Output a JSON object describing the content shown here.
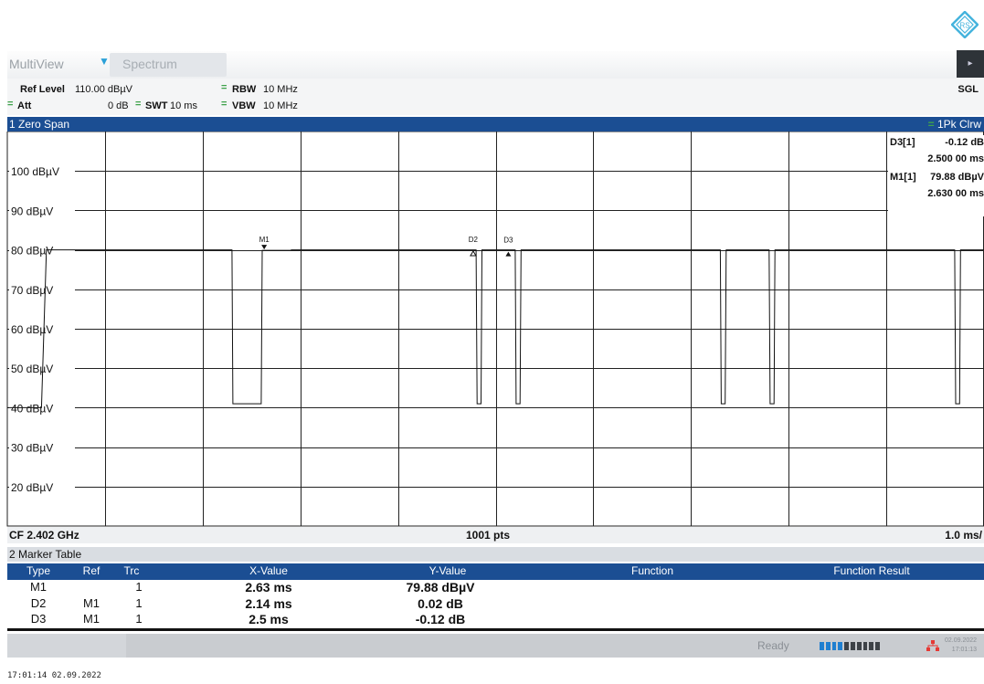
{
  "tabs": {
    "multiview": "MultiView",
    "spectrum": "Spectrum"
  },
  "header": {
    "ref_level_label": "Ref Level",
    "ref_level_value": "110.00 dBµV",
    "att_label": "Att",
    "att_value": "0 dB",
    "swt_label": "SWT",
    "swt_value": "10 ms",
    "rbw_label": "RBW",
    "rbw_value": "10 MHz",
    "vbw_label": "VBW",
    "vbw_value": "10 MHz",
    "mode": "SGL"
  },
  "panel": {
    "title": "1 Zero Span",
    "trace_info": "1Pk Clrw"
  },
  "marker_info": {
    "d3_label": "D3[1]",
    "d3_value": "-0.12 dB",
    "d3_time": "2.500 00 ms",
    "m1_label": "M1[1]",
    "m1_value": "79.88 dBµV",
    "m1_time": "2.630 00 ms"
  },
  "chart_data": {
    "type": "line",
    "xlabel": "",
    "ylabel": "",
    "y_unit": "dBµV",
    "ylim": [
      10,
      110
    ],
    "yticks": [
      100,
      90,
      80,
      70,
      60,
      50,
      40,
      30,
      20
    ],
    "ytick_labels": [
      "100 dBµV",
      "90 dBµV",
      "80 dBµV",
      "70 dBµV",
      "60 dBµV",
      "50 dBµV",
      "40 dBµV",
      "30 dBµV",
      "20 dBµV"
    ],
    "xlim_ms": [
      0,
      10
    ],
    "grid": true,
    "series": [
      {
        "x": [
          0,
          0.1,
          0.35,
          0.4,
          0.6,
          1.4,
          2.3,
          2.31,
          2.6,
          2.61,
          2.9,
          2.91,
          4.8,
          4.81,
          4.85,
          4.86,
          5.2,
          5.21,
          5.25,
          5.26,
          7.3,
          7.31,
          7.35,
          7.36,
          7.8,
          7.81,
          7.85,
          7.86,
          9.7,
          9.71,
          9.75,
          9.76,
          10
        ],
        "y": [
          40,
          40,
          40,
          80,
          80,
          80,
          80,
          41,
          41,
          79.88,
          79.88,
          80,
          80,
          41,
          41,
          80,
          80,
          41,
          41,
          80,
          80,
          41,
          41,
          80,
          80,
          41,
          41,
          80,
          80,
          41,
          41,
          80,
          80
        ]
      }
    ],
    "markers": [
      {
        "label": "M1",
        "x_ms": 2.63,
        "y": 79.88,
        "symbol": "filled-down"
      },
      {
        "label": "D2",
        "x_ms": 4.77,
        "y": 79.9,
        "symbol": "hollow-up"
      },
      {
        "label": "D3",
        "x_ms": 5.13,
        "y": 79.76,
        "symbol": "filled-up"
      }
    ]
  },
  "footer": {
    "cf": "CF 2.402 GHz",
    "pts": "1001 pts",
    "span": "1.0 ms/"
  },
  "marker_table": {
    "title": "2 Marker Table",
    "headers": [
      "Type",
      "Ref",
      "Trc",
      "X-Value",
      "Y-Value",
      "Function",
      "Function Result"
    ],
    "rows": [
      [
        "M1",
        "",
        "1",
        "2.63 ms",
        "79.88 dBµV",
        "",
        ""
      ],
      [
        "D2",
        "M1",
        "1",
        "2.14 ms",
        "0.02 dB",
        "",
        ""
      ],
      [
        "D3",
        "M1",
        "1",
        "2.5 ms",
        "-0.12 dB",
        "",
        ""
      ]
    ]
  },
  "status": {
    "text": "Ready",
    "date": "02.09.2022",
    "time": "17:01:13"
  },
  "timestamp": "17:01:14  02.09.2022",
  "colors": {
    "accent": "#1b4e93",
    "trace": "#111111",
    "grid": "#222222",
    "indicator": "#3fa24b",
    "progress_on": "#1f7fd0",
    "progress_off": "#3d4247",
    "network": "#e53935"
  }
}
